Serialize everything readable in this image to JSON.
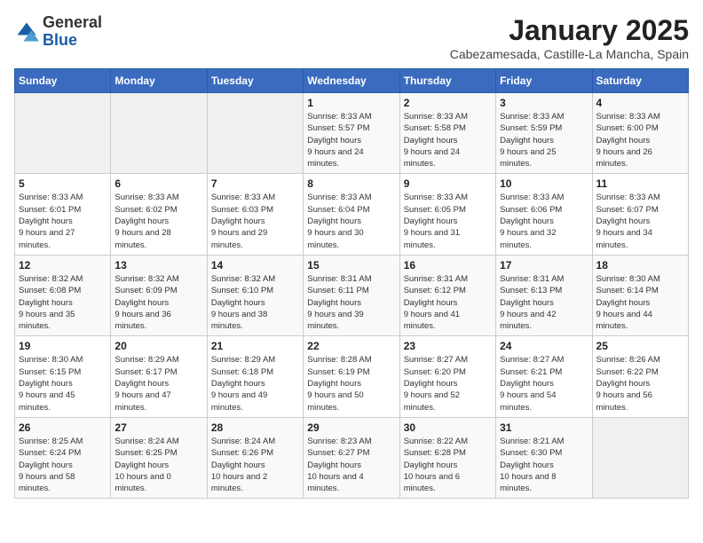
{
  "logo": {
    "general": "General",
    "blue": "Blue"
  },
  "header": {
    "title": "January 2025",
    "subtitle": "Cabezamesada, Castille-La Mancha, Spain"
  },
  "weekdays": [
    "Sunday",
    "Monday",
    "Tuesday",
    "Wednesday",
    "Thursday",
    "Friday",
    "Saturday"
  ],
  "weeks": [
    [
      {
        "day": "",
        "empty": true
      },
      {
        "day": "",
        "empty": true
      },
      {
        "day": "",
        "empty": true
      },
      {
        "day": "1",
        "sunrise": "8:33 AM",
        "sunset": "5:57 PM",
        "daylight": "9 hours and 24 minutes."
      },
      {
        "day": "2",
        "sunrise": "8:33 AM",
        "sunset": "5:58 PM",
        "daylight": "9 hours and 24 minutes."
      },
      {
        "day": "3",
        "sunrise": "8:33 AM",
        "sunset": "5:59 PM",
        "daylight": "9 hours and 25 minutes."
      },
      {
        "day": "4",
        "sunrise": "8:33 AM",
        "sunset": "6:00 PM",
        "daylight": "9 hours and 26 minutes."
      }
    ],
    [
      {
        "day": "5",
        "sunrise": "8:33 AM",
        "sunset": "6:01 PM",
        "daylight": "9 hours and 27 minutes."
      },
      {
        "day": "6",
        "sunrise": "8:33 AM",
        "sunset": "6:02 PM",
        "daylight": "9 hours and 28 minutes."
      },
      {
        "day": "7",
        "sunrise": "8:33 AM",
        "sunset": "6:03 PM",
        "daylight": "9 hours and 29 minutes."
      },
      {
        "day": "8",
        "sunrise": "8:33 AM",
        "sunset": "6:04 PM",
        "daylight": "9 hours and 30 minutes."
      },
      {
        "day": "9",
        "sunrise": "8:33 AM",
        "sunset": "6:05 PM",
        "daylight": "9 hours and 31 minutes."
      },
      {
        "day": "10",
        "sunrise": "8:33 AM",
        "sunset": "6:06 PM",
        "daylight": "9 hours and 32 minutes."
      },
      {
        "day": "11",
        "sunrise": "8:33 AM",
        "sunset": "6:07 PM",
        "daylight": "9 hours and 34 minutes."
      }
    ],
    [
      {
        "day": "12",
        "sunrise": "8:32 AM",
        "sunset": "6:08 PM",
        "daylight": "9 hours and 35 minutes."
      },
      {
        "day": "13",
        "sunrise": "8:32 AM",
        "sunset": "6:09 PM",
        "daylight": "9 hours and 36 minutes."
      },
      {
        "day": "14",
        "sunrise": "8:32 AM",
        "sunset": "6:10 PM",
        "daylight": "9 hours and 38 minutes."
      },
      {
        "day": "15",
        "sunrise": "8:31 AM",
        "sunset": "6:11 PM",
        "daylight": "9 hours and 39 minutes."
      },
      {
        "day": "16",
        "sunrise": "8:31 AM",
        "sunset": "6:12 PM",
        "daylight": "9 hours and 41 minutes."
      },
      {
        "day": "17",
        "sunrise": "8:31 AM",
        "sunset": "6:13 PM",
        "daylight": "9 hours and 42 minutes."
      },
      {
        "day": "18",
        "sunrise": "8:30 AM",
        "sunset": "6:14 PM",
        "daylight": "9 hours and 44 minutes."
      }
    ],
    [
      {
        "day": "19",
        "sunrise": "8:30 AM",
        "sunset": "6:15 PM",
        "daylight": "9 hours and 45 minutes."
      },
      {
        "day": "20",
        "sunrise": "8:29 AM",
        "sunset": "6:17 PM",
        "daylight": "9 hours and 47 minutes."
      },
      {
        "day": "21",
        "sunrise": "8:29 AM",
        "sunset": "6:18 PM",
        "daylight": "9 hours and 49 minutes."
      },
      {
        "day": "22",
        "sunrise": "8:28 AM",
        "sunset": "6:19 PM",
        "daylight": "9 hours and 50 minutes."
      },
      {
        "day": "23",
        "sunrise": "8:27 AM",
        "sunset": "6:20 PM",
        "daylight": "9 hours and 52 minutes."
      },
      {
        "day": "24",
        "sunrise": "8:27 AM",
        "sunset": "6:21 PM",
        "daylight": "9 hours and 54 minutes."
      },
      {
        "day": "25",
        "sunrise": "8:26 AM",
        "sunset": "6:22 PM",
        "daylight": "9 hours and 56 minutes."
      }
    ],
    [
      {
        "day": "26",
        "sunrise": "8:25 AM",
        "sunset": "6:24 PM",
        "daylight": "9 hours and 58 minutes."
      },
      {
        "day": "27",
        "sunrise": "8:24 AM",
        "sunset": "6:25 PM",
        "daylight": "10 hours and 0 minutes."
      },
      {
        "day": "28",
        "sunrise": "8:24 AM",
        "sunset": "6:26 PM",
        "daylight": "10 hours and 2 minutes."
      },
      {
        "day": "29",
        "sunrise": "8:23 AM",
        "sunset": "6:27 PM",
        "daylight": "10 hours and 4 minutes."
      },
      {
        "day": "30",
        "sunrise": "8:22 AM",
        "sunset": "6:28 PM",
        "daylight": "10 hours and 6 minutes."
      },
      {
        "day": "31",
        "sunrise": "8:21 AM",
        "sunset": "6:30 PM",
        "daylight": "10 hours and 8 minutes."
      },
      {
        "day": "",
        "empty": true
      }
    ]
  ],
  "labels": {
    "sunrise": "Sunrise:",
    "sunset": "Sunset:",
    "daylight": "Daylight hours"
  }
}
